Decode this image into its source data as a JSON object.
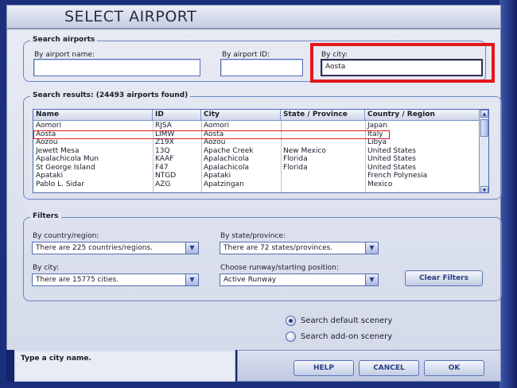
{
  "window": {
    "title": "SELECT AIRPORT"
  },
  "search_airports": {
    "group_label": "Search airports",
    "by_name_label": "By airport name:",
    "by_name_value": "",
    "by_id_label": "By airport ID:",
    "by_id_value": "",
    "by_city_label": "By city:",
    "by_city_value": "Aosta"
  },
  "results": {
    "group_label": "Search results: (24493 airports found)",
    "columns": [
      "Name",
      "ID",
      "City",
      "State / Province",
      "Country / Region"
    ],
    "rows": [
      [
        "Aomori",
        "RJSA",
        "Aomori",
        "",
        "Japan"
      ],
      [
        "Aosta",
        "LIMW",
        "Aosta",
        "",
        "Italy"
      ],
      [
        "Aozou",
        "Z19X",
        "Aozou",
        "",
        "Libya"
      ],
      [
        "Jewett Mesa",
        "13Q",
        "Apache Creek",
        "New Mexico",
        "United States"
      ],
      [
        "Apalachicola Mun",
        "KAAF",
        "Apalachicola",
        "Florida",
        "United States"
      ],
      [
        "St George Island",
        "F47",
        "Apalachicola",
        "Florida",
        "United States"
      ],
      [
        "Apataki",
        "NTGD",
        "Apataki",
        "",
        "French Polynesia"
      ],
      [
        "Pablo L. Sidar",
        "AZG",
        "Apatzingan",
        "",
        "Mexico"
      ]
    ],
    "selected_index": 1
  },
  "filters": {
    "group_label": "Filters",
    "country_label": "By country/region:",
    "country_value": "There are 225 countries/regions.",
    "state_label": "By state/province:",
    "state_value": "There are 72 states/provinces.",
    "city_label": "By city:",
    "city_value": "There are 15775 cities.",
    "runway_label": "Choose runway/starting position:",
    "runway_value": "Active Runway",
    "clear_label": "Clear Filters"
  },
  "scenery": {
    "default_label": "Search default scenery",
    "addon_label": "Search add-on scenery",
    "selected": "default"
  },
  "status": {
    "text": "Type a city name."
  },
  "buttons": {
    "help": "HELP",
    "cancel": "CANCEL",
    "ok": "OK"
  },
  "colors": {
    "highlight": "#e3161c",
    "frame": "#1b2f7c",
    "panel": "#e3e7f1"
  }
}
